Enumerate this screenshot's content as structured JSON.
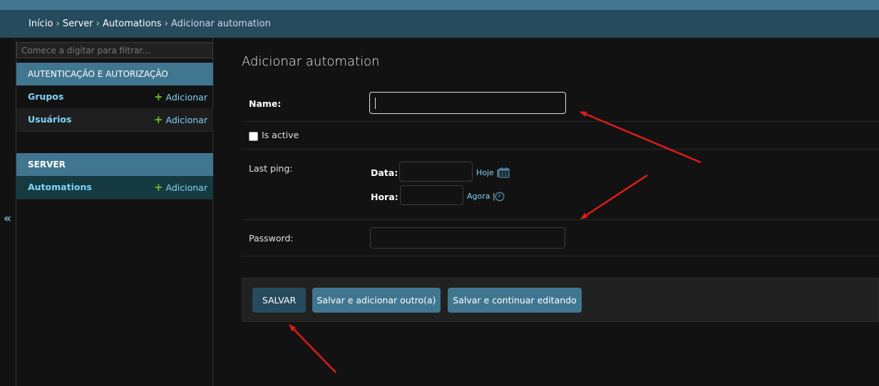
{
  "breadcrumbs": {
    "home": "Início",
    "app": "Server",
    "model": "Automations",
    "current": "Adicionar automation",
    "separator": "›"
  },
  "nav": {
    "toggle_label": "«",
    "filter_placeholder": "Comece a digitar para filtrar...",
    "modules": [
      {
        "caption": "AUTENTICAÇÃO E AUTORIZAÇÃO",
        "models": [
          {
            "name": "Grupos",
            "add_label": "Adicionar"
          },
          {
            "name": "Usuários",
            "add_label": "Adicionar"
          }
        ]
      },
      {
        "caption": "SERVER",
        "models": [
          {
            "name": "Automations",
            "add_label": "Adicionar"
          }
        ]
      }
    ]
  },
  "form": {
    "title": "Adicionar automation",
    "name_label": "Name:",
    "name_value": "",
    "is_active_label": "Is active",
    "is_active_checked": false,
    "last_ping_label": "Last ping:",
    "date_label": "Data:",
    "date_value": "",
    "date_shortcut": "Hoje",
    "time_label": "Hora:",
    "time_value": "",
    "time_shortcut": "Agora",
    "shortcut_sep": "|",
    "password_label": "Password:",
    "password_value": ""
  },
  "buttons": {
    "save": "SALVAR",
    "save_add_another": "Salvar e adicionar outro(a)",
    "save_continue": "Salvar e continuar editando"
  },
  "icons": {
    "add": "plus-icon",
    "calendar": "calendar-icon",
    "clock": "clock-icon",
    "collapse": "chevron-double-left-icon"
  },
  "colors": {
    "header": "#417690",
    "breadcrumbs": "#264b5d",
    "link": "#81d4fa",
    "add_plus": "#70bf2b",
    "annotation_arrow": "#e01b1b"
  }
}
